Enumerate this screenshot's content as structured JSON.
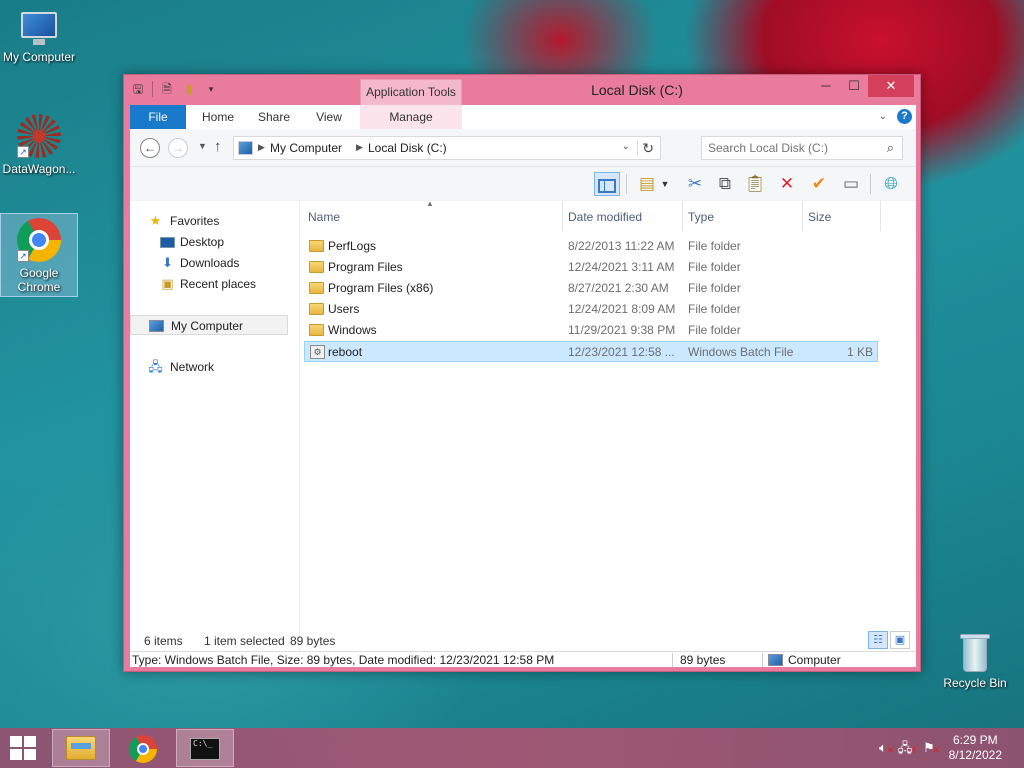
{
  "desktop": {
    "icons": [
      {
        "label": "My Computer"
      },
      {
        "label": "DataWagon..."
      },
      {
        "label": "Google Chrome"
      },
      {
        "label": "Recycle Bin"
      }
    ]
  },
  "window": {
    "title": "Local Disk (C:)",
    "context_tab_group": "Application Tools",
    "ribbon_tabs": {
      "file": "File",
      "home": "Home",
      "share": "Share",
      "view": "View",
      "manage": "Manage"
    },
    "address": {
      "crumbs": [
        "My Computer",
        "Local Disk (C:)"
      ]
    },
    "search": {
      "placeholder": "Search Local Disk (C:)"
    },
    "nav_pane": {
      "favorites": "Favorites",
      "desktop": "Desktop",
      "downloads": "Downloads",
      "recent_places": "Recent places",
      "my_computer": "My Computer",
      "network": "Network"
    },
    "columns": {
      "name": "Name",
      "date_modified": "Date modified",
      "type": "Type",
      "size": "Size"
    },
    "files": [
      {
        "name": "PerfLogs",
        "date": "8/22/2013 11:22 AM",
        "type": "File folder",
        "size": "",
        "kind": "folder"
      },
      {
        "name": "Program Files",
        "date": "12/24/2021 3:11 AM",
        "type": "File folder",
        "size": "",
        "kind": "folder"
      },
      {
        "name": "Program Files (x86)",
        "date": "8/27/2021 2:30 AM",
        "type": "File folder",
        "size": "",
        "kind": "folder"
      },
      {
        "name": "Users",
        "date": "12/24/2021 8:09 AM",
        "type": "File folder",
        "size": "",
        "kind": "folder"
      },
      {
        "name": "Windows",
        "date": "11/29/2021 9:38 PM",
        "type": "File folder",
        "size": "",
        "kind": "folder"
      },
      {
        "name": "reboot",
        "date": "12/23/2021 12:58 ...",
        "type": "Windows Batch File",
        "size": "1 KB",
        "kind": "batch"
      }
    ],
    "status": {
      "item_count": "6 items",
      "selected": "1 item selected",
      "selected_size": "89 bytes"
    },
    "infobar": {
      "details": "Type: Windows Batch File, Size: 89 bytes, Date modified: 12/23/2021 12:58 PM",
      "size": "89 bytes",
      "location": "Computer"
    }
  },
  "taskbar": {
    "clock": {
      "time": "6:29 PM",
      "date": "8/12/2022"
    }
  }
}
